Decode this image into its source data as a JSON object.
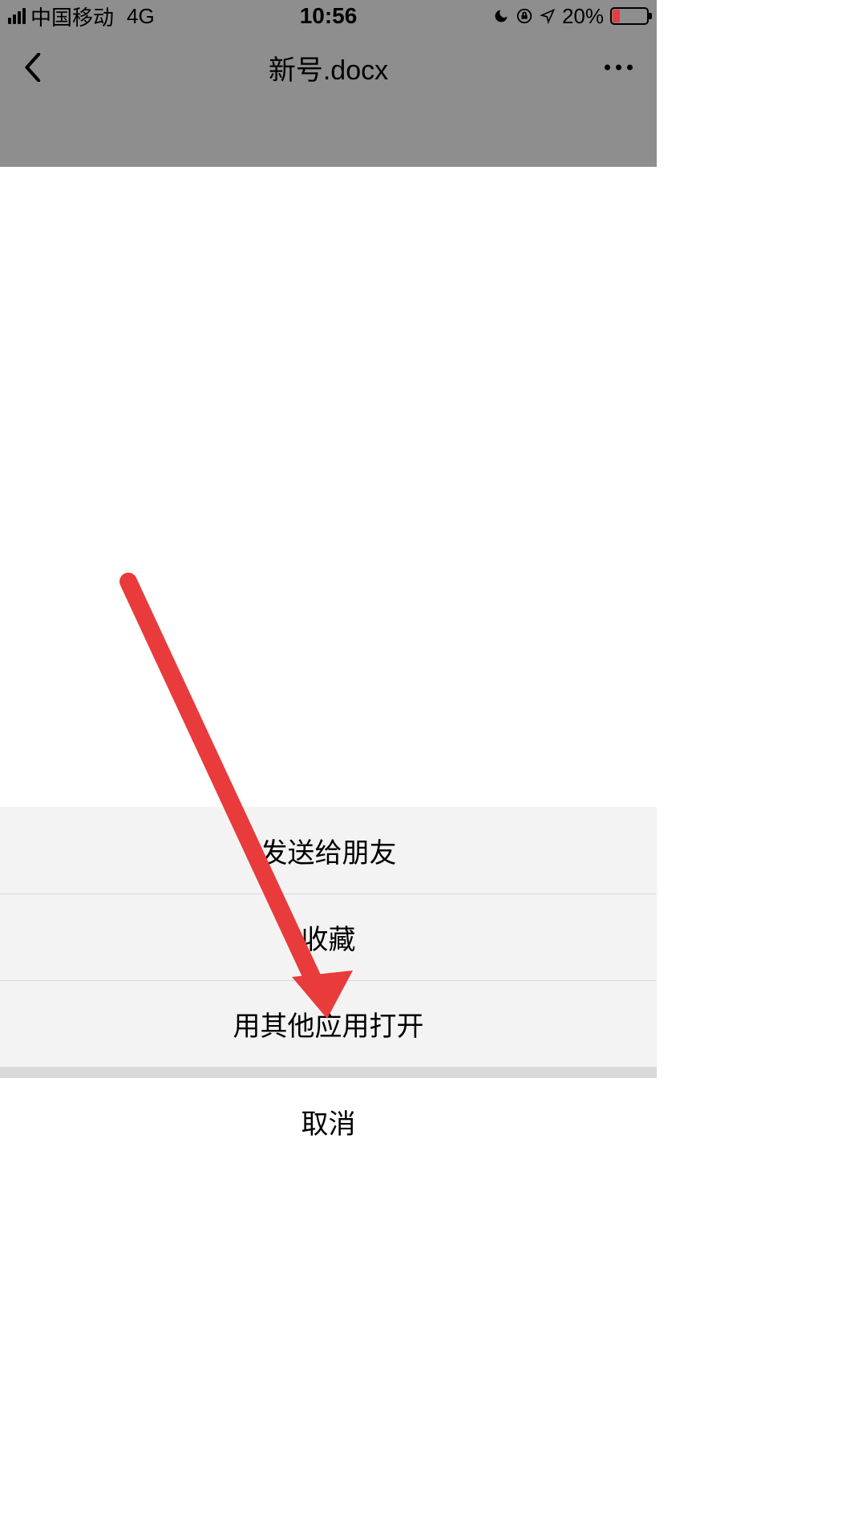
{
  "status": {
    "carrier": "中国移动",
    "network": "4G",
    "time": "10:56",
    "battery_pct": "20%"
  },
  "nav": {
    "title": "新号.docx"
  },
  "sheet": {
    "items": [
      "发送给朋友",
      "收藏",
      "用其他应用打开"
    ],
    "cancel": "取消"
  },
  "annotation": {
    "arrow_color": "#e93b3b"
  }
}
